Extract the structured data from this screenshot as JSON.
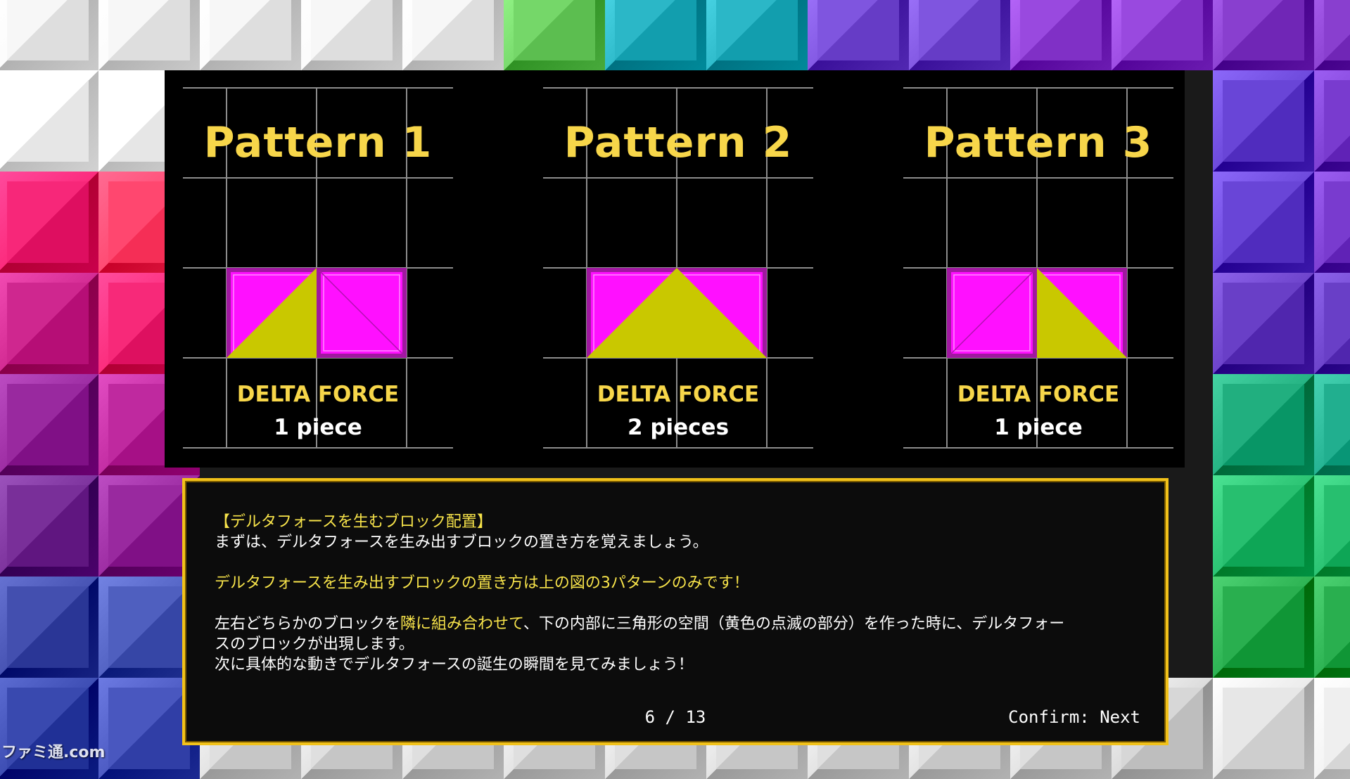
{
  "patterns": [
    {
      "title": "Pattern 1",
      "label": "DELTA FORCE",
      "count": "1 piece",
      "shape": "left-triangle"
    },
    {
      "title": "Pattern 2",
      "label": "DELTA FORCE",
      "count": "2 pieces",
      "shape": "center-triangle"
    },
    {
      "title": "Pattern 3",
      "label": "DELTA FORCE",
      "count": "1 piece",
      "shape": "right-triangle"
    }
  ],
  "dialog": {
    "heading": "【デルタフォースを生むブロック配置】",
    "line1": "まずは、デルタフォースを生み出すブロックの置き方を覚えましょう。",
    "highlight": "デルタフォースを生み出すブロックの置き方は上の図の3パターンのみです！",
    "line3_pre": "左右どちらかのブロックを",
    "line3_hl": "隣に組み合わせて",
    "line3_post": "、下の内部に三角形の空間（黄色の点滅の部分）を作った時に、デルタフォー",
    "line4": "スのブロックが出現します。",
    "line5": "次に具体的な動きでデルタフォースの誕生の瞬間を見てみましょう！"
  },
  "pager": "6 / 13",
  "confirm": "Confirm: Next",
  "watermark": "ファミ通.com",
  "colors": {
    "panel_bg": "#000000",
    "block_magenta": "#ff10ff",
    "triangle_yellow": "#c9c800",
    "title_yellow": "#f7d64a",
    "dialog_border": "#f2c21a"
  }
}
